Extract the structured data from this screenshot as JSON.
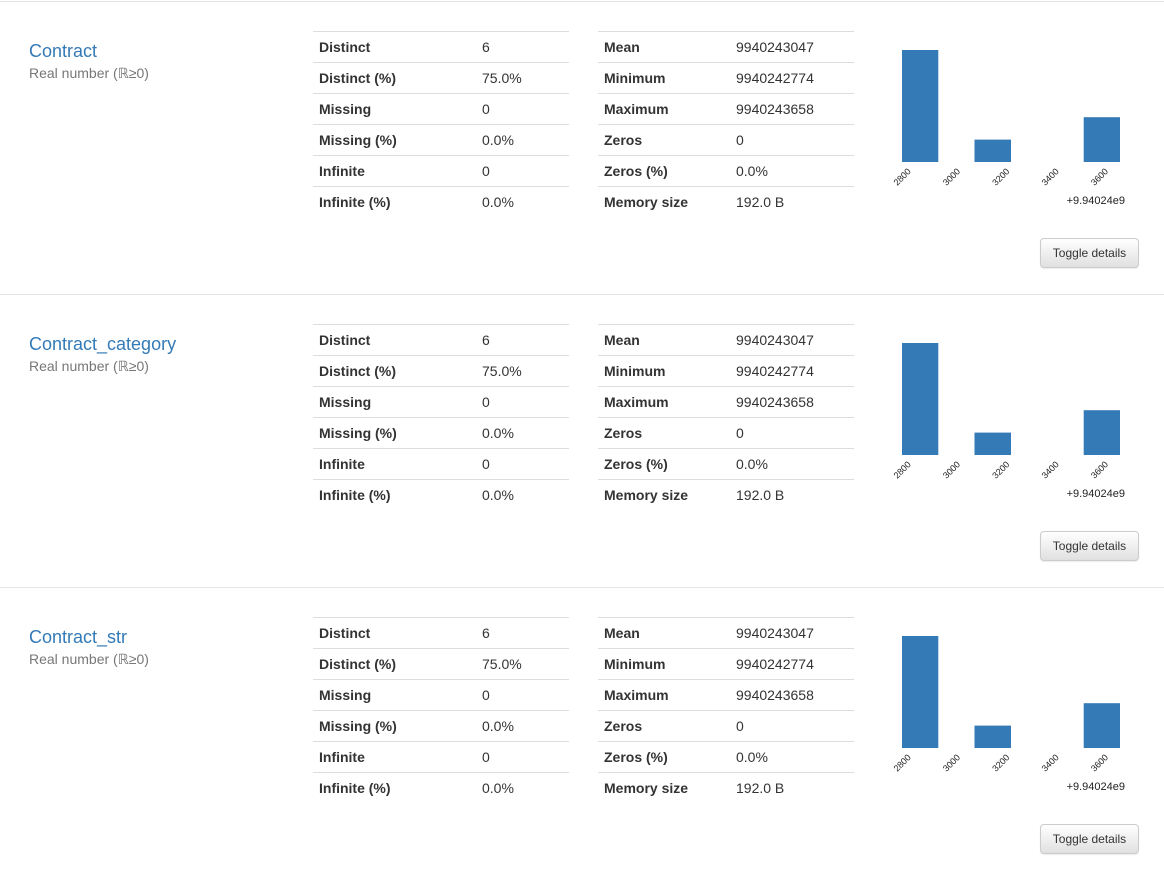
{
  "colors": {
    "bar": "#337ab7",
    "link": "#337ab7"
  },
  "variables": [
    {
      "name": "Contract",
      "type": "Real number (ℝ≥0)",
      "stats_left": [
        {
          "label": "Distinct",
          "value": "6"
        },
        {
          "label": "Distinct (%)",
          "value": "75.0%"
        },
        {
          "label": "Missing",
          "value": "0"
        },
        {
          "label": "Missing (%)",
          "value": "0.0%"
        },
        {
          "label": "Infinite",
          "value": "0"
        },
        {
          "label": "Infinite (%)",
          "value": "0.0%"
        }
      ],
      "stats_right": [
        {
          "label": "Mean",
          "value": "9940243047"
        },
        {
          "label": "Minimum",
          "value": "9940242774"
        },
        {
          "label": "Maximum",
          "value": "9940243658"
        },
        {
          "label": "Zeros",
          "value": "0"
        },
        {
          "label": "Zeros (%)",
          "value": "0.0%"
        },
        {
          "label": "Memory size",
          "value": "192.0 B"
        }
      ],
      "toggle_label": "Toggle details"
    },
    {
      "name": "Contract_category",
      "type": "Real number (ℝ≥0)",
      "stats_left": [
        {
          "label": "Distinct",
          "value": "6"
        },
        {
          "label": "Distinct (%)",
          "value": "75.0%"
        },
        {
          "label": "Missing",
          "value": "0"
        },
        {
          "label": "Missing (%)",
          "value": "0.0%"
        },
        {
          "label": "Infinite",
          "value": "0"
        },
        {
          "label": "Infinite (%)",
          "value": "0.0%"
        }
      ],
      "stats_right": [
        {
          "label": "Mean",
          "value": "9940243047"
        },
        {
          "label": "Minimum",
          "value": "9940242774"
        },
        {
          "label": "Maximum",
          "value": "9940243658"
        },
        {
          "label": "Zeros",
          "value": "0"
        },
        {
          "label": "Zeros (%)",
          "value": "0.0%"
        },
        {
          "label": "Memory size",
          "value": "192.0 B"
        }
      ],
      "toggle_label": "Toggle details"
    },
    {
      "name": "Contract_str",
      "type": "Real number (ℝ≥0)",
      "stats_left": [
        {
          "label": "Distinct",
          "value": "6"
        },
        {
          "label": "Distinct (%)",
          "value": "75.0%"
        },
        {
          "label": "Missing",
          "value": "0"
        },
        {
          "label": "Missing (%)",
          "value": "0.0%"
        },
        {
          "label": "Infinite",
          "value": "0"
        },
        {
          "label": "Infinite (%)",
          "value": "0.0%"
        }
      ],
      "stats_right": [
        {
          "label": "Mean",
          "value": "9940243047"
        },
        {
          "label": "Minimum",
          "value": "9940242774"
        },
        {
          "label": "Maximum",
          "value": "9940243658"
        },
        {
          "label": "Zeros",
          "value": "0"
        },
        {
          "label": "Zeros (%)",
          "value": "0.0%"
        },
        {
          "label": "Memory size",
          "value": "192.0 B"
        }
      ],
      "toggle_label": "Toggle details"
    }
  ],
  "chart_data": [
    {
      "type": "bar",
      "bins": [
        [
          2774,
          2921
        ],
        [
          2921,
          3068
        ],
        [
          3068,
          3216
        ],
        [
          3216,
          3363
        ],
        [
          3363,
          3511
        ],
        [
          3511,
          3658
        ]
      ],
      "values": [
        5,
        0,
        1,
        0,
        0,
        2
      ],
      "xlim": [
        2774,
        3658
      ],
      "xticks": [
        2800,
        3000,
        3200,
        3400,
        3600
      ],
      "xtick_labels": [
        "2800",
        "3000",
        "3200",
        "3400",
        "3600"
      ],
      "offset_label": "+9.94024e9",
      "ylim": [
        0,
        5
      ],
      "grid": false
    },
    {
      "type": "bar",
      "bins": [
        [
          2774,
          2921
        ],
        [
          2921,
          3068
        ],
        [
          3068,
          3216
        ],
        [
          3216,
          3363
        ],
        [
          3363,
          3511
        ],
        [
          3511,
          3658
        ]
      ],
      "values": [
        5,
        0,
        1,
        0,
        0,
        2
      ],
      "xlim": [
        2774,
        3658
      ],
      "xticks": [
        2800,
        3000,
        3200,
        3400,
        3600
      ],
      "xtick_labels": [
        "2800",
        "3000",
        "3200",
        "3400",
        "3600"
      ],
      "offset_label": "+9.94024e9",
      "ylim": [
        0,
        5
      ],
      "grid": false
    },
    {
      "type": "bar",
      "bins": [
        [
          2774,
          2921
        ],
        [
          2921,
          3068
        ],
        [
          3068,
          3216
        ],
        [
          3216,
          3363
        ],
        [
          3363,
          3511
        ],
        [
          3511,
          3658
        ]
      ],
      "values": [
        5,
        0,
        1,
        0,
        0,
        2
      ],
      "xlim": [
        2774,
        3658
      ],
      "xticks": [
        2800,
        3000,
        3200,
        3400,
        3600
      ],
      "xtick_labels": [
        "2800",
        "3000",
        "3200",
        "3400",
        "3600"
      ],
      "offset_label": "+9.94024e9",
      "ylim": [
        0,
        5
      ],
      "grid": false
    }
  ]
}
